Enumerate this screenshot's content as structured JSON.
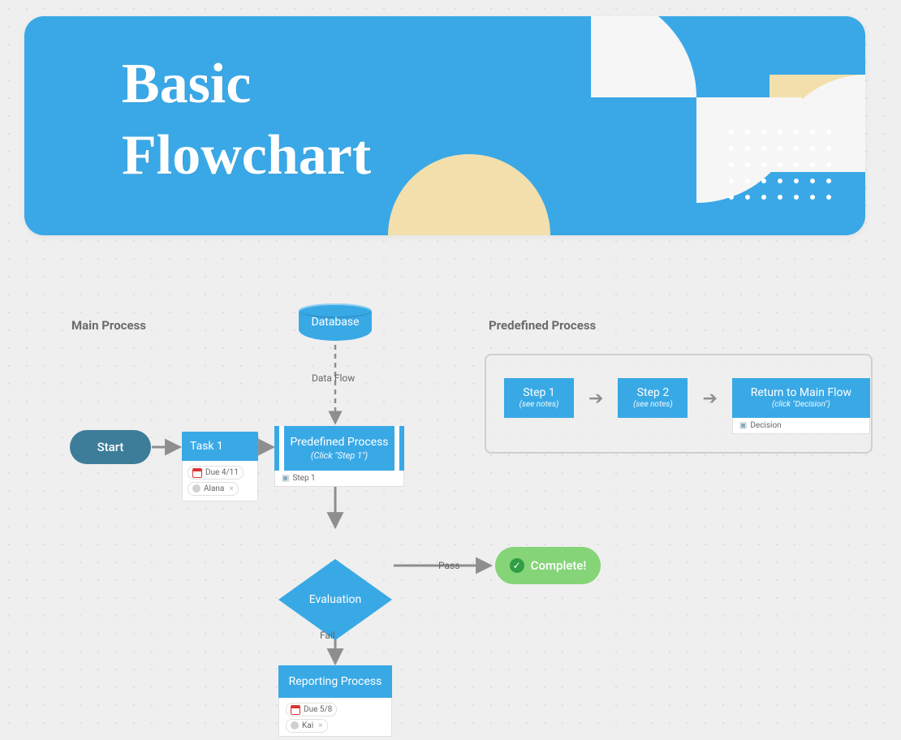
{
  "banner": {
    "title": "Basic\nFlowchart"
  },
  "sections": {
    "main": "Main Process",
    "predef": "Predefined Process"
  },
  "nodes": {
    "start": "Start",
    "task1": {
      "label": "Task 1",
      "due": "Due 4/11",
      "assignee": "Alana"
    },
    "predefProcess": {
      "label": "Predefined Process",
      "sub": "(Click \"Step 1\")",
      "link": "Step 1"
    },
    "database": "Database",
    "dataFlowLabel": "Data Flow",
    "decision": "Evaluation",
    "passLabel": "Pass",
    "failLabel": "Fail",
    "complete": "Complete!",
    "reporting": {
      "label": "Reporting Process",
      "due": "Due 5/8",
      "assignee": "Kai"
    }
  },
  "predefPanel": {
    "step1": {
      "label": "Step 1",
      "sub": "(see notes)"
    },
    "step2": {
      "label": "Step 2",
      "sub": "(see notes)"
    },
    "return": {
      "label": "Return to  Main Flow",
      "sub": "(click \"Decision\")",
      "link": "Decision"
    }
  },
  "colors": {
    "bannerBlue": "#3aa8e6",
    "nodeBlue": "#39a9e6",
    "startTeal": "#3d7d99",
    "green": "#85d477",
    "cream": "#f2dfac"
  }
}
